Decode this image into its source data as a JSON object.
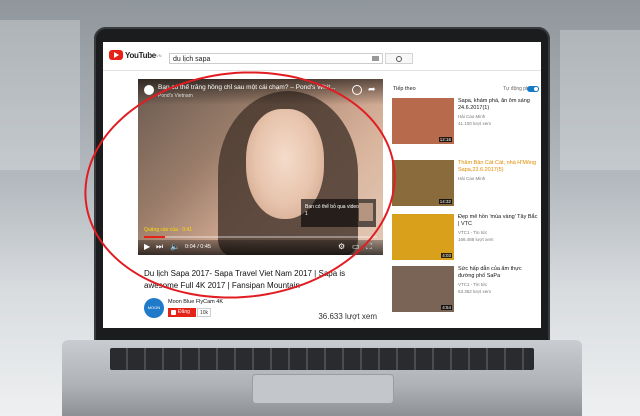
{
  "header": {
    "logo_text": "YouTube",
    "logo_sup": "VN",
    "search_value": "du lịch sapa"
  },
  "player": {
    "video_overlay_title": "Bạn có thể trắng hồng chỉ sau một cái chạm? – Pond's Whit...",
    "video_overlay_channel": "Pond's Vietnam",
    "ad_bubble_text": "Bạn có thể bỏ qua video trong 1",
    "ad_label": "Quảng cáo của · 0:41",
    "time": "0:04 / 0:45",
    "progress": 0.09
  },
  "video_info": {
    "title": "Du lịch Sapa 2017- Sapa Travel Viet Nam 2017 | Sapa is awesome Full 4K 2017 | Fansipan Mountain",
    "channel_name": "Moon Blue FlyCam 4K",
    "channel_avatar_text": "MOON BLUE",
    "subscribe_label": "Đăng ký",
    "subscriber_count": "10k",
    "views": "36.633 lượt xem"
  },
  "sidebar": {
    "heading": "Tiếp theo",
    "autoplay_label": "Tự động phát",
    "items": [
      {
        "title": "Sapa, khám phá, ăn ôm sáng 24.6.2017(1)",
        "channel": "Hải Cao Minh",
        "views": "41.100 lượt xem",
        "duration": "12:16",
        "thumb_color": "#b86a4c"
      },
      {
        "title": "Thăm Bản Cát Cát, nhà H'Mông Sapa,23.6.2017(5)",
        "channel": "Hải Cao Minh",
        "views": "",
        "duration": "14:32",
        "thumb_color": "#8a6b3c",
        "title_color": "#e08a00"
      },
      {
        "title": "Đẹp mê hồn 'mùa vàng' Tây Bắc | VTC",
        "channel": "VTC1 - Tin tức",
        "views": "168.488 lượt xem",
        "duration": "4:03",
        "thumb_color": "#d9a11b"
      },
      {
        "title": "Sức hấp dẫn của ẩm thực đường phố SaPa",
        "channel": "VTC1 - Tin tức",
        "views": "63.362 lượt xem",
        "duration": "4:54",
        "thumb_color": "#7a6456"
      }
    ]
  }
}
